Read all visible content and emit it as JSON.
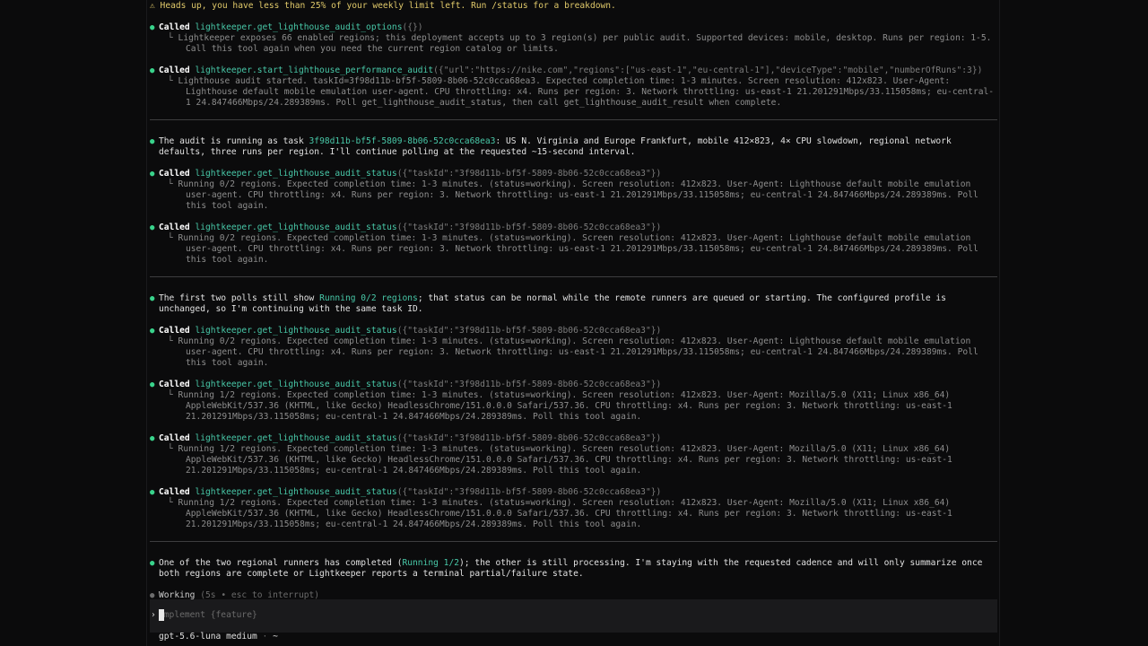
{
  "warning": "⚠ Heads up, you have less than 25% of your weekly limit left. Run /status for a breakdown.",
  "called_label": "Called",
  "items": [
    {
      "kind": "call",
      "fn": "lightkeeper.get_lighthouse_audit_options",
      "args": "({})",
      "output": "└ Lightkeeper exposes 66 enabled regions; this deployment accepts up to 3 region(s) per public audit. Supported devices: mobile, desktop. Runs per region: 1-5. Call this tool again when you need the current region catalog or limits."
    },
    {
      "kind": "call",
      "fn": "lightkeeper.start_lighthouse_performance_audit",
      "args": "({\"url\":\"https://nike.com\",\"regions\":[\"us-east-1\",\"eu-central-1\"],\"deviceType\":\"mobile\",\"numberOfRuns\":3})",
      "output": "└ Lighthouse audit started. taskId=3f98d11b-bf5f-5809-8b06-52c0cca68ea3. Expected completion time: 1-3 minutes. Screen resolution: 412x823. User-Agent: Lighthouse default mobile emulation user-agent. CPU throttling: x4. Runs per region: 3. Network throttling: us-east-1 21.201291Mbps/33.115058ms; eu-central-1 24.847466Mbps/24.289389ms. Poll get_lighthouse_audit_status, then call get_lighthouse_audit_result when complete."
    },
    {
      "kind": "divider"
    },
    {
      "kind": "msg",
      "pre": "The audit is running as task ",
      "hl": "3f98d11b-bf5f-5809-8b06-52c0cca68ea3",
      "post": ": US N. Virginia and Europe Frankfurt, mobile 412×823, 4× CPU slowdown, regional network defaults, three runs per region. I'll continue polling at the requested ~15-second interval."
    },
    {
      "kind": "call",
      "fn": "lightkeeper.get_lighthouse_audit_status",
      "args": "({\"taskId\":\"3f98d11b-bf5f-5809-8b06-52c0cca68ea3\"})",
      "output": "└ Running 0/2 regions. Expected completion time: 1-3 minutes. (status=working). Screen resolution: 412x823. User-Agent: Lighthouse default mobile emulation user-agent. CPU throttling: x4. Runs per region: 3. Network throttling: us-east-1 21.201291Mbps/33.115058ms; eu-central-1 24.847466Mbps/24.289389ms. Poll this tool again."
    },
    {
      "kind": "call",
      "fn": "lightkeeper.get_lighthouse_audit_status",
      "args": "({\"taskId\":\"3f98d11b-bf5f-5809-8b06-52c0cca68ea3\"})",
      "output": "└ Running 0/2 regions. Expected completion time: 1-3 minutes. (status=working). Screen resolution: 412x823. User-Agent: Lighthouse default mobile emulation user-agent. CPU throttling: x4. Runs per region: 3. Network throttling: us-east-1 21.201291Mbps/33.115058ms; eu-central-1 24.847466Mbps/24.289389ms. Poll this tool again."
    },
    {
      "kind": "divider"
    },
    {
      "kind": "msg",
      "pre": "The first two polls still show ",
      "hl": "Running 0/2 regions",
      "post": "; that status can be normal while the remote runners are queued or starting. The configured profile is unchanged, so I'm continuing with the same task ID."
    },
    {
      "kind": "call",
      "fn": "lightkeeper.get_lighthouse_audit_status",
      "args": "({\"taskId\":\"3f98d11b-bf5f-5809-8b06-52c0cca68ea3\"})",
      "output": "└ Running 0/2 regions. Expected completion time: 1-3 minutes. (status=working). Screen resolution: 412x823. User-Agent: Lighthouse default mobile emulation user-agent. CPU throttling: x4. Runs per region: 3. Network throttling: us-east-1 21.201291Mbps/33.115058ms; eu-central-1 24.847466Mbps/24.289389ms. Poll this tool again."
    },
    {
      "kind": "call",
      "fn": "lightkeeper.get_lighthouse_audit_status",
      "args": "({\"taskId\":\"3f98d11b-bf5f-5809-8b06-52c0cca68ea3\"})",
      "output": "└ Running 1/2 regions. Expected completion time: 1-3 minutes. (status=working). Screen resolution: 412x823. User-Agent: Mozilla/5.0 (X11; Linux x86_64) AppleWebKit/537.36 (KHTML, like Gecko) HeadlessChrome/151.0.0.0 Safari/537.36. CPU throttling: x4. Runs per region: 3. Network throttling: us-east-1 21.201291Mbps/33.115058ms; eu-central-1 24.847466Mbps/24.289389ms. Poll this tool again."
    },
    {
      "kind": "call",
      "fn": "lightkeeper.get_lighthouse_audit_status",
      "args": "({\"taskId\":\"3f98d11b-bf5f-5809-8b06-52c0cca68ea3\"})",
      "output": "└ Running 1/2 regions. Expected completion time: 1-3 minutes. (status=working). Screen resolution: 412x823. User-Agent: Mozilla/5.0 (X11; Linux x86_64) AppleWebKit/537.36 (KHTML, like Gecko) HeadlessChrome/151.0.0.0 Safari/537.36. CPU throttling: x4. Runs per region: 3. Network throttling: us-east-1 21.201291Mbps/33.115058ms; eu-central-1 24.847466Mbps/24.289389ms. Poll this tool again."
    },
    {
      "kind": "call",
      "fn": "lightkeeper.get_lighthouse_audit_status",
      "args": "({\"taskId\":\"3f98d11b-bf5f-5809-8b06-52c0cca68ea3\"})",
      "output": "└ Running 1/2 regions. Expected completion time: 1-3 minutes. (status=working). Screen resolution: 412x823. User-Agent: Mozilla/5.0 (X11; Linux x86_64) AppleWebKit/537.36 (KHTML, like Gecko) HeadlessChrome/151.0.0.0 Safari/537.36. CPU throttling: x4. Runs per region: 3. Network throttling: us-east-1 21.201291Mbps/33.115058ms; eu-central-1 24.847466Mbps/24.289389ms. Poll this tool again."
    },
    {
      "kind": "divider"
    },
    {
      "kind": "msg",
      "pre": "One of the two regional runners has completed (",
      "hl": "Running 1/2",
      "post": "); the other is still processing. I'm staying with the requested cadence and will only summarize once both regions are complete or Lightkeeper reports a terminal partial/failure state."
    }
  ],
  "status": {
    "label": "Working",
    "detail": "(5s • esc to interrupt)"
  },
  "input": {
    "prompt": "›",
    "placeholder": "Implement {feature}"
  },
  "footer": {
    "model": "gpt-5.6-luna medium",
    "sep": "·",
    "cwd": "~"
  }
}
